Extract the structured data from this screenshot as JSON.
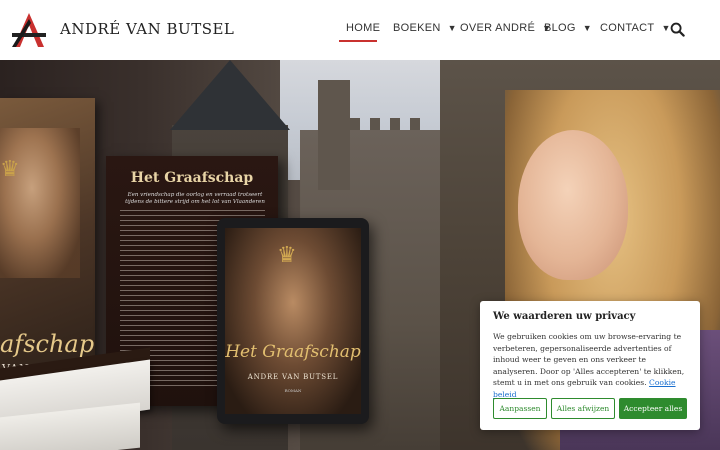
{
  "header": {
    "site_title": "ANDRÉ VAN BUTSEL",
    "logo_letter": "A",
    "nav": [
      {
        "label": "HOME",
        "caret": ""
      },
      {
        "label": "BOEKEN",
        "caret": "▼"
      },
      {
        "label": "OVER ANDRÉ",
        "caret": "▼"
      },
      {
        "label": "BLOG",
        "caret": "▼"
      },
      {
        "label": "CONTACT",
        "caret": "▼"
      }
    ],
    "active_nav": "HOME",
    "search_icon": "search-icon",
    "accent_color": "#c9312f"
  },
  "hero": {
    "book_left": {
      "title": "afschap",
      "author": "VAN BUTSEL"
    },
    "book_back": {
      "title": "Het Graafschap",
      "subtitle": "Een vriendschap die oorlog en verraad trotseert tijdens de bittere strijd om het lot van Vlaanderen"
    },
    "tablet": {
      "title": "Het Graafschap",
      "author": "ANDRE VAN BUTSEL",
      "label": "ROMAN"
    }
  },
  "cookie_banner": {
    "title": "We waarderen uw privacy",
    "text": "We gebruiken cookies om uw browse-ervaring te verbeteren, gepersonaliseerde advertenties of inhoud weer te geven en ons verkeer te analyseren. Door op 'Alles accepteren' te klikken, stemt u in met ons gebruik van cookies.",
    "link": "Cookie beleid",
    "buttons": {
      "customize": "Aanpassen",
      "reject": "Alles afwijzen",
      "accept": "Accepteer alles"
    },
    "button_color": "#2e8b2e"
  }
}
